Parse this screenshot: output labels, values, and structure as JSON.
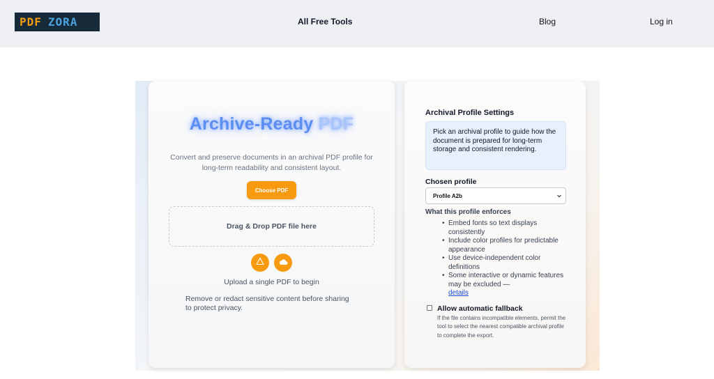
{
  "header": {
    "logo_part1": "PDF",
    "logo_part2": "ZORA",
    "nav": {
      "tools": "All Free Tools",
      "blog": "Blog",
      "login": "Log in"
    }
  },
  "hero": {
    "title_main": "Archive-Ready",
    "title_fade": "PDF",
    "description": "Convert and preserve documents in an archival PDF profile for long-term readability and consistent layout.",
    "choose_button": "Choose PDF",
    "dropzone": "Drag & Drop PDF file here",
    "upload_hint": "Upload a single PDF to begin",
    "privacy_note": "Remove or redact sensitive content before sharing to protect privacy."
  },
  "settings": {
    "title": "Archival Profile Settings",
    "info": "Pick an archival profile to guide how the document is prepared for long-term storage and consistent rendering.",
    "profile_label": "Chosen profile",
    "profile_value": "Profile A2b",
    "enforces_label": "What this profile enforces",
    "rules": [
      "Embed fonts so text displays consistently",
      "Include color profiles for predictable appearance",
      "Use device-independent color definitions",
      "Some interactive or dynamic features may be excluded —"
    ],
    "details_link": "details",
    "fallback_label": "Allow automatic fallback",
    "fallback_checked": false,
    "fallback_help": "If the file contains incompatible elements, permit the tool to select the nearest compatible archival profile to complete the export."
  },
  "colors": {
    "accent": "#f79a10",
    "logo_bg": "#172a3a",
    "title_blue": "#5b8ef0",
    "info_bg": "#e6f1fc",
    "link": "#1d4ed8"
  },
  "icons": {
    "logo": "pdfzora-logo",
    "upload_a": "warning-triangle-icon",
    "upload_b": "cloud-icon",
    "select": "chevron-down-icon"
  }
}
